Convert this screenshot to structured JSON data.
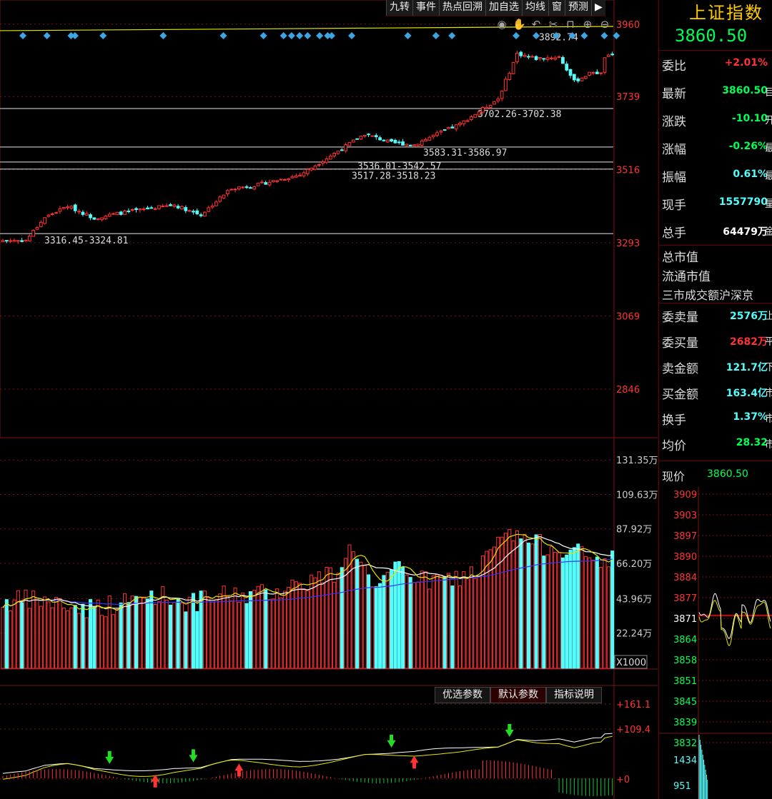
{
  "toolbar": {
    "buttons": [
      "九转",
      "事件",
      "热点回溯",
      "加自选",
      "均线",
      "窗",
      "预测"
    ],
    "collapse_icon": "collapse-right-icon"
  },
  "chart_tools": [
    "eye-icon",
    "hand-icon",
    "undo-icon",
    "cut-icon",
    "lock-icon",
    "zoom-in-icon",
    "zoom-out-icon"
  ],
  "colors": {
    "up": "#ff3333",
    "down": "#54fcfc",
    "ma_yellow": "#e6e600",
    "ma_white": "#ffffff",
    "ma_blue": "#3535ff",
    "grid": "#7a1414",
    "bg": "#000000"
  },
  "right_panel": {
    "title": "上证指数",
    "price": "3860.50",
    "quotes": [
      {
        "label": "委比",
        "value": "+2.01%",
        "color": "#ff3333",
        "suffix": ""
      },
      {
        "label": "最新",
        "value": "3860.50",
        "color": "#00ff55",
        "suffix": "目"
      },
      {
        "label": "涨跌",
        "value": "-10.10",
        "color": "#00ff55",
        "suffix": "开"
      },
      {
        "label": "涨幅",
        "value": "-0.26%",
        "color": "#00ff55",
        "suffix": "最"
      },
      {
        "label": "振幅",
        "value": "0.61%",
        "color": "#54fcfc",
        "suffix": "最"
      },
      {
        "label": "现手",
        "value": "1557790",
        "color": "#54fcfc",
        "suffix": "量"
      },
      {
        "label": "总手",
        "value": "64479万",
        "color": "#ffffff",
        "suffix": "金"
      }
    ],
    "market": [
      "总市值",
      "流通市值",
      "三市成交额沪深京"
    ],
    "orders": [
      {
        "label": "委卖量",
        "value": "2576万",
        "color": "#54fcfc",
        "suffix": "上"
      },
      {
        "label": "委买量",
        "value": "2682万",
        "color": "#ff3333",
        "suffix": "平"
      },
      {
        "label": "卖金额",
        "value": "121.7亿",
        "color": "#54fcfc",
        "suffix": "下"
      },
      {
        "label": "买金额",
        "value": "163.4亿",
        "color": "#54fcfc",
        "suffix": "市"
      },
      {
        "label": "换手",
        "value": "1.37%",
        "color": "#54fcfc",
        "suffix": "市"
      },
      {
        "label": "均价",
        "value": "28.32",
        "color": "#00ff55",
        "suffix": "市"
      }
    ],
    "xianjia_label": "现价",
    "xianjia_value": "3860.50",
    "mini_price_ticks": [
      "3909",
      "3903",
      "3897",
      "3890",
      "3884",
      "3877",
      "3871",
      "3864",
      "3858",
      "3851",
      "3845",
      "3839",
      "3832"
    ],
    "mini_volume_ticks": [
      "1434",
      "951"
    ]
  },
  "indicator_buttons": [
    "优选参数",
    "默认参数",
    "指标说明"
  ],
  "chart_data": {
    "type": "candlestick",
    "price_axis": {
      "ticks": [
        "3960",
        "3739",
        "3516",
        "3293",
        "3069",
        "2846"
      ],
      "range": [
        2700,
        3990
      ]
    },
    "volume_axis": {
      "ticks": [
        "131.35万",
        "109.63万",
        "87.92万",
        "66.20万",
        "43.96万",
        "22.24万"
      ],
      "unit_label": "X1000",
      "range": [
        0,
        140
      ]
    },
    "indicator_axis": {
      "ticks": [
        "+161.1",
        "+109.4",
        "+0"
      ]
    },
    "price_annotations": [
      "3892.74",
      "3702.26-3702.38",
      "3583.31-3586.97",
      "3536.01-3542.57",
      "3517.28-3518.23",
      "3316.45-3324.81"
    ],
    "gap_lines": [
      3702.3,
      3585.1,
      3539.3,
      3517.7,
      3320.6
    ],
    "trend_line": [
      3940,
      3953
    ],
    "close_anchors": [
      [
        0,
        3300
      ],
      [
        6,
        3300
      ],
      [
        11,
        3370
      ],
      [
        17,
        3405
      ],
      [
        24,
        3368
      ],
      [
        30,
        3382
      ],
      [
        40,
        3400
      ],
      [
        45,
        3408
      ],
      [
        52,
        3378
      ],
      [
        60,
        3460
      ],
      [
        65,
        3465
      ],
      [
        78,
        3500
      ],
      [
        86,
        3558
      ],
      [
        95,
        3625
      ],
      [
        102,
        3598
      ],
      [
        108,
        3592
      ],
      [
        113,
        3620
      ],
      [
        120,
        3655
      ],
      [
        130,
        3732
      ],
      [
        135,
        3870
      ],
      [
        140,
        3855
      ],
      [
        146,
        3860
      ],
      [
        150,
        3785
      ],
      [
        155,
        3815
      ],
      [
        157,
        3808
      ],
      [
        158,
        3860
      ],
      [
        160,
        3862
      ]
    ],
    "volume_anchors": [
      [
        0,
        42
      ],
      [
        10,
        43
      ],
      [
        20,
        38
      ],
      [
        30,
        40
      ],
      [
        40,
        47
      ],
      [
        50,
        41
      ],
      [
        58,
        46
      ],
      [
        68,
        47
      ],
      [
        80,
        55
      ],
      [
        87,
        60
      ],
      [
        92,
        78
      ],
      [
        98,
        46
      ],
      [
        104,
        66
      ],
      [
        110,
        55
      ],
      [
        118,
        56
      ],
      [
        125,
        62
      ],
      [
        130,
        80
      ],
      [
        135,
        84
      ],
      [
        140,
        78
      ],
      [
        148,
        76
      ],
      [
        155,
        68
      ],
      [
        160,
        70
      ]
    ],
    "markers": {
      "green_down": [
        28,
        50,
        102,
        133
      ],
      "red_up": [
        40,
        62,
        108
      ]
    }
  }
}
